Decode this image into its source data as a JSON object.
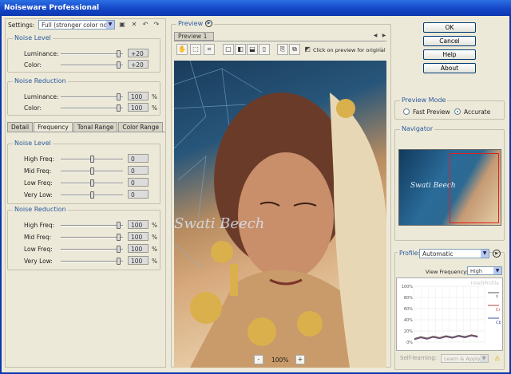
{
  "window": {
    "title": "Noiseware Professional"
  },
  "settings": {
    "label": "Settings:",
    "value": "Full (stronger color noise)"
  },
  "noise_level_top": {
    "title": "Noise Level",
    "rows": [
      {
        "label": "Luminance:",
        "value": "+20",
        "level": 0.95
      },
      {
        "label": "Color:",
        "value": "+20",
        "level": 0.95
      }
    ]
  },
  "noise_reduction_top": {
    "title": "Noise Reduction",
    "unit": "%",
    "rows": [
      {
        "label": "Luminance:",
        "value": "100",
        "level": 0.95
      },
      {
        "label": "Color:",
        "value": "100",
        "level": 0.95
      }
    ]
  },
  "tabs": [
    "Detail",
    "Frequency",
    "Tonal Range",
    "Color Range"
  ],
  "active_tab": "Frequency",
  "noise_level_freq": {
    "title": "Noise Level",
    "rows": [
      {
        "label": "High Freq:",
        "value": "0",
        "level": 0.5
      },
      {
        "label": "Mid Freq:",
        "value": "0",
        "level": 0.5
      },
      {
        "label": "Low Freq:",
        "value": "0",
        "level": 0.5
      },
      {
        "label": "Very Low:",
        "value": "0",
        "level": 0.5
      }
    ]
  },
  "noise_reduction_freq": {
    "title": "Noise Reduction",
    "unit": "%",
    "rows": [
      {
        "label": "High Freq:",
        "value": "100",
        "level": 0.95
      },
      {
        "label": "Mid Freq:",
        "value": "100",
        "level": 0.95
      },
      {
        "label": "Low Freq:",
        "value": "100",
        "level": 0.95
      },
      {
        "label": "Very Low:",
        "value": "100",
        "level": 0.95
      }
    ]
  },
  "preview": {
    "title": "Preview",
    "tab": "Preview 1",
    "hint": "Click on preview for original",
    "zoom": "100%",
    "minus": "-",
    "plus": "+",
    "watermark": "Swati Beech"
  },
  "buttons": {
    "ok": "OK",
    "cancel": "Cancel",
    "help": "Help",
    "about": "About"
  },
  "preview_mode": {
    "title": "Preview Mode",
    "fast": "Fast Preview",
    "accurate": "Accurate",
    "selected": "accurate"
  },
  "navigator": {
    "title": "Navigator",
    "watermark": "Swati Beech"
  },
  "profile": {
    "label": "Profile:",
    "value": "Automatic",
    "view_freq_label": "View Frequency:",
    "view_freq_value": "High",
    "brand": "IntelliProfile",
    "self_learning_label": "Self-learning:",
    "self_learning_value": "Learn & Apply",
    "y_ticks": [
      "100%",
      "80%",
      "60%",
      "40%",
      "20%",
      "0%"
    ],
    "channels": [
      "Y",
      "Cr",
      "Cb"
    ]
  },
  "colors": {
    "title_bar": "#1547c6",
    "group_title": "#2c5aa0",
    "active_value_bg": "#dcdcdc"
  }
}
